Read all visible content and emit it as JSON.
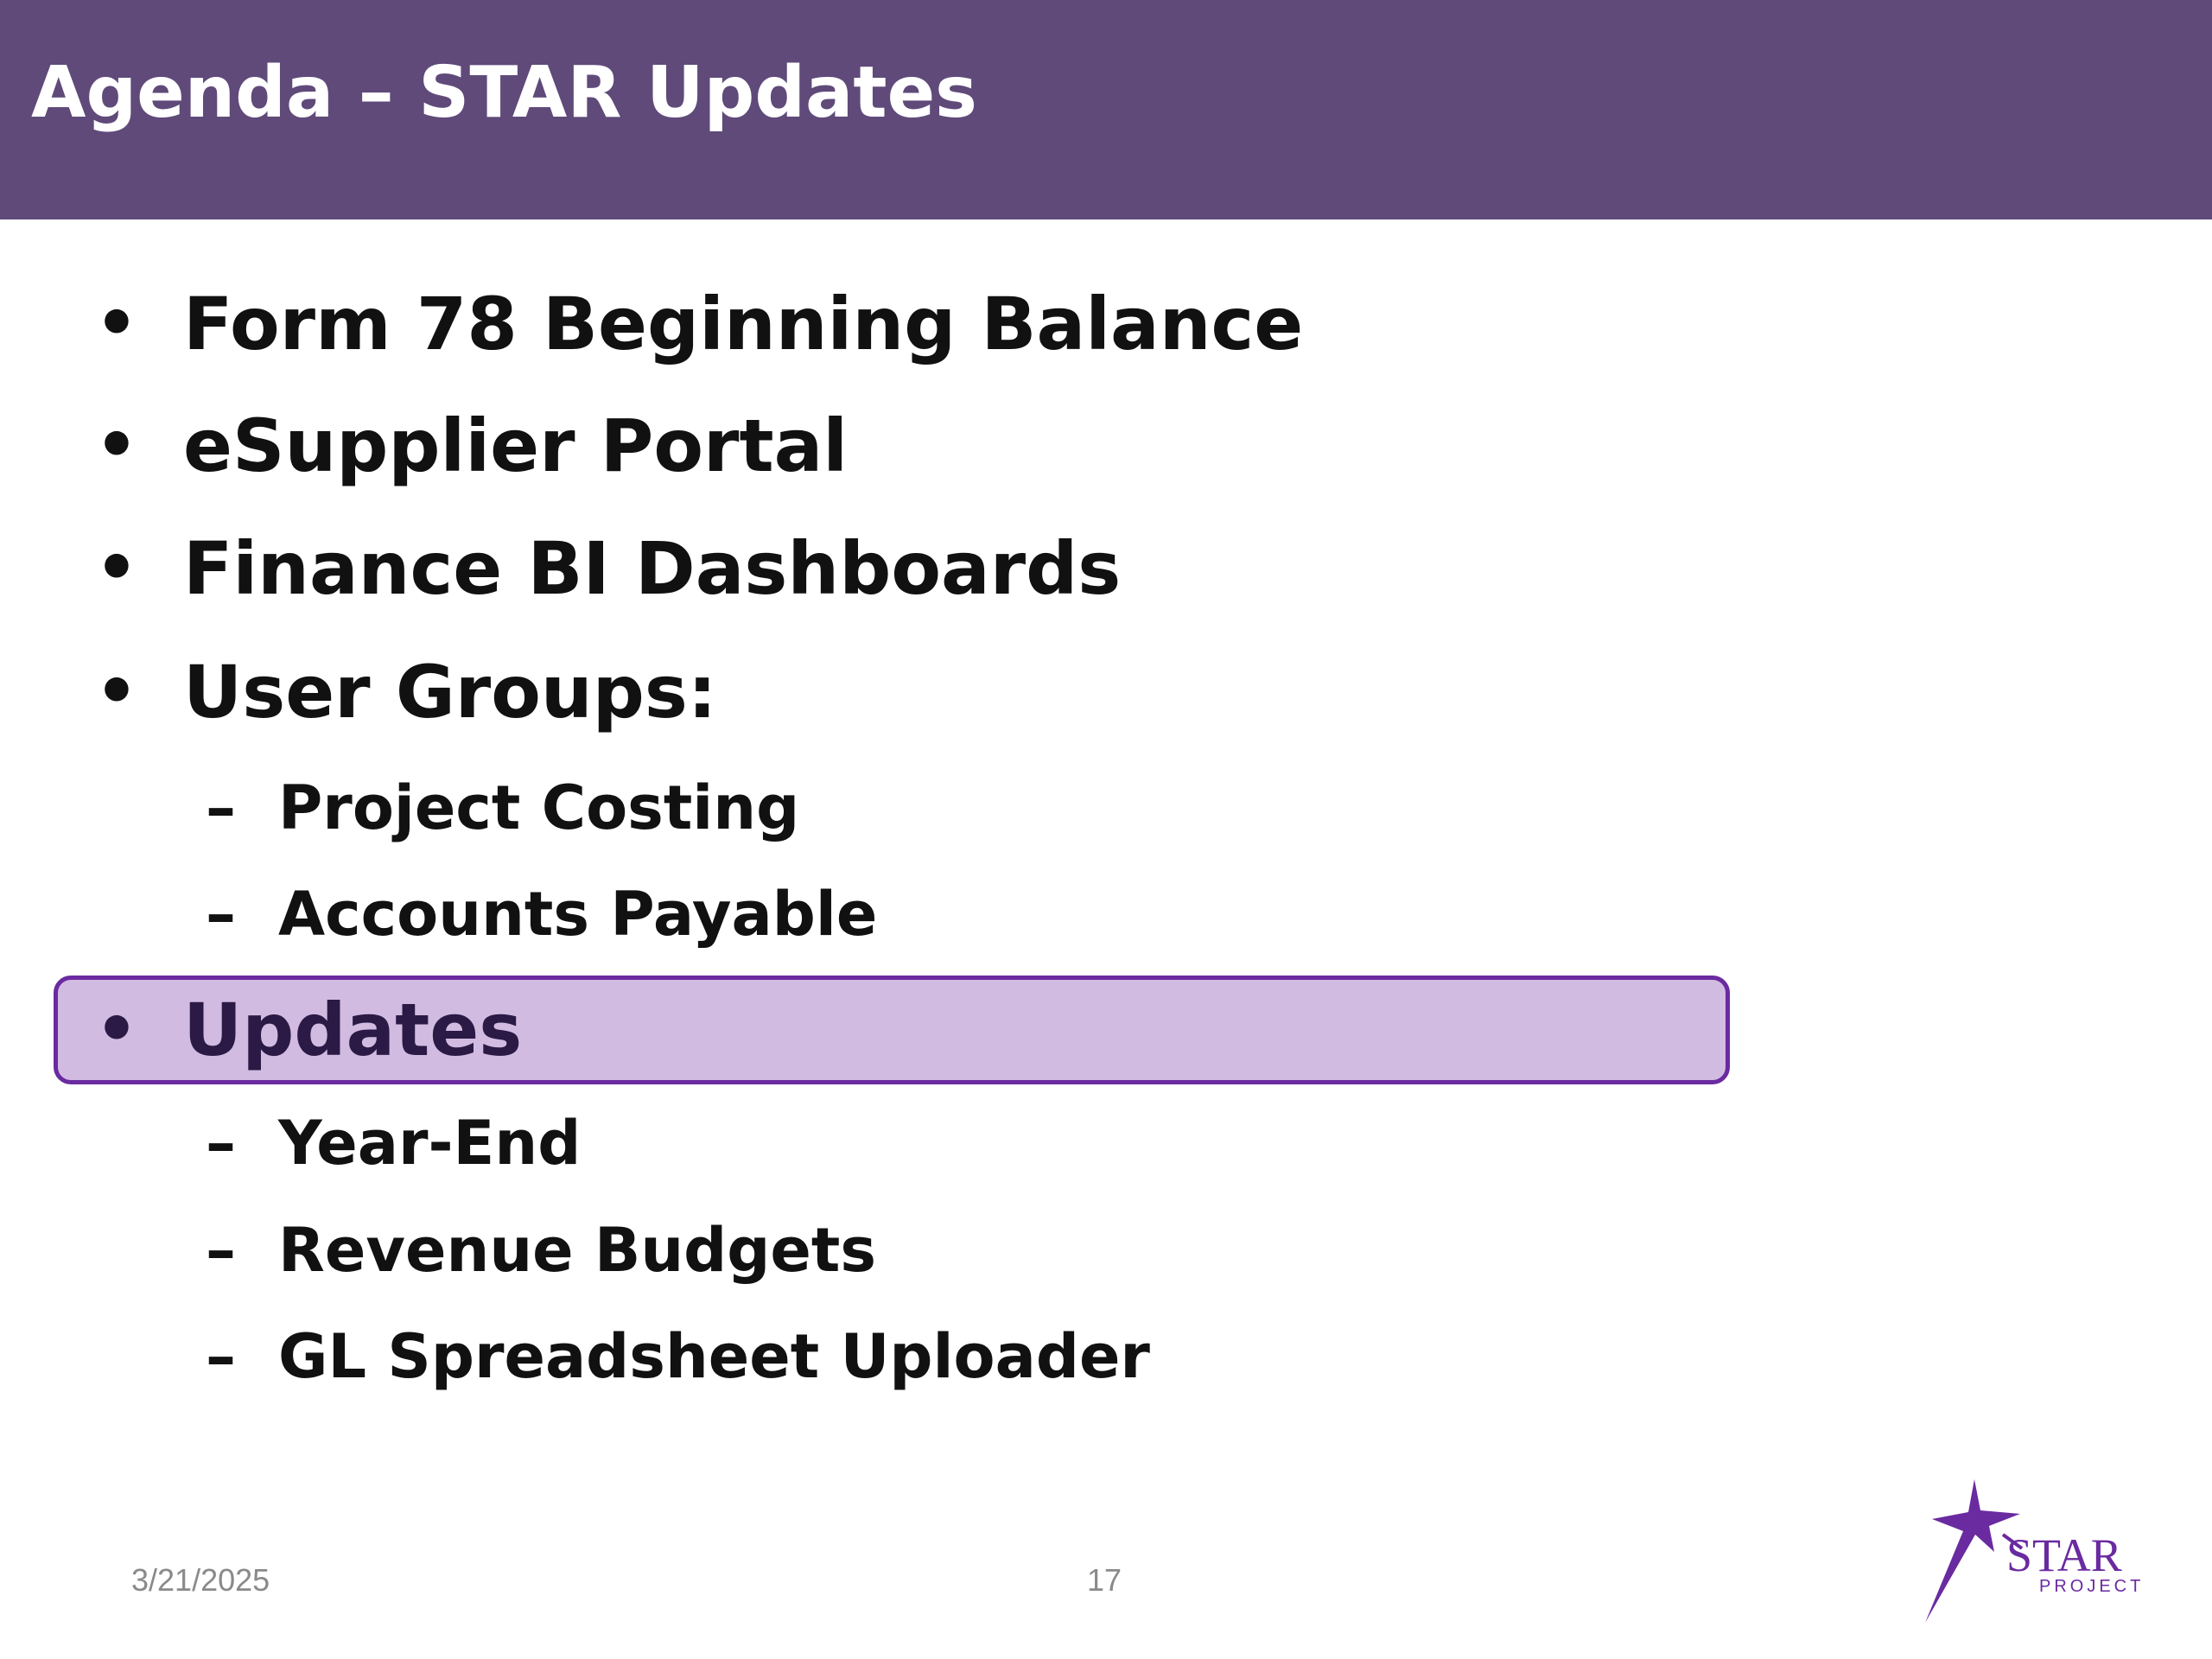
{
  "slide": {
    "title": "Agenda – STAR Updates",
    "items": [
      {
        "marker": "•",
        "text": "Form 78 Beginning Balance"
      },
      {
        "marker": "•",
        "text": "eSupplier Portal"
      },
      {
        "marker": "•",
        "text": "Finance BI Dashboards"
      },
      {
        "marker": "•",
        "text": "User Groups:"
      }
    ],
    "user_groups": [
      {
        "marker": "–",
        "text": "Project Costing"
      },
      {
        "marker": "–",
        "text": "Accounts Payable"
      }
    ],
    "highlighted_item": {
      "marker": "•",
      "text": "Updates"
    },
    "updates": [
      {
        "marker": "–",
        "text": "Year-End"
      },
      {
        "marker": "–",
        "text": "Revenue Budgets"
      },
      {
        "marker": "–",
        "text": "GL Spreadsheet Uploader"
      }
    ]
  },
  "footer": {
    "date": "3/21/2025",
    "page_number": "17"
  },
  "logo": {
    "icon": "star-project-logo",
    "word": "STAR",
    "sub": "PROJECT"
  },
  "colors": {
    "header_bg": "#5f4a7a",
    "highlight_bg": "#d2bbe1",
    "highlight_border": "#6a2aa0"
  }
}
